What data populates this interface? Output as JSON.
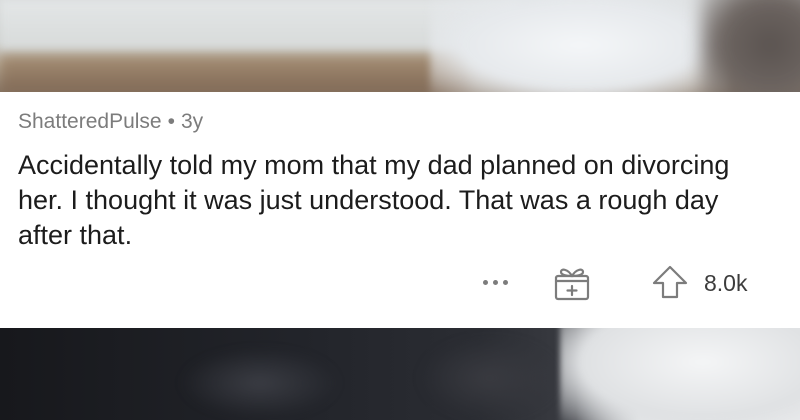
{
  "comment": {
    "author": "ShatteredPulse",
    "separator": "•",
    "age": "3y",
    "body": "Accidentally told my mom that my dad planned on divorcing her. I thought it was just understood. That was a rough day after that."
  },
  "actions": {
    "more_icon": "more-horizontal-icon",
    "award_icon": "gift-icon",
    "upvote_icon": "upvote-arrow-icon",
    "score": "8.0k"
  },
  "colors": {
    "card_background": "#ffffff",
    "meta_text": "#7c7c7c",
    "body_text": "#1c1c1c",
    "icon": "#7c7c7c"
  }
}
